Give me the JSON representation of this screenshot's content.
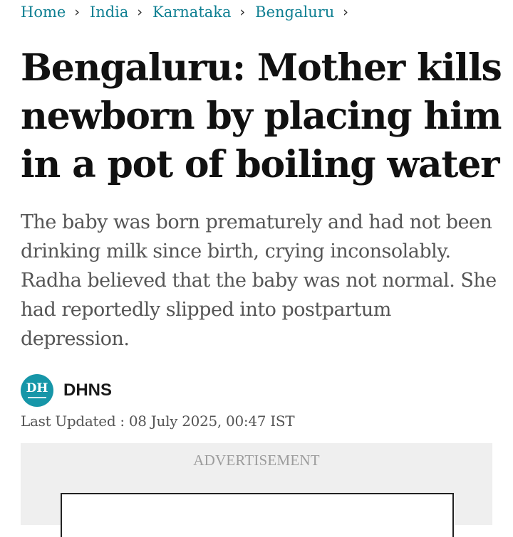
{
  "breadcrumb": {
    "items": [
      {
        "label": "Home"
      },
      {
        "label": "India"
      },
      {
        "label": "Karnataka"
      },
      {
        "label": "Bengaluru"
      }
    ],
    "separator": "›"
  },
  "article": {
    "headline": "Bengaluru: Mother kills newborn by placing him in a pot of boiling water",
    "summary": "The baby was born prematurely and had not been drinking milk since birth, crying inconsolably. Radha believed that the baby was not normal. She had reportedly slipped into postpartum depression.",
    "author": {
      "logo_text": "DH",
      "name": "DHNS"
    },
    "last_updated": "Last Updated : 08 July 2025, 00:47 IST"
  },
  "ad": {
    "label": "ADVERTISEMENT"
  },
  "colors": {
    "link": "#0e7f92",
    "avatar_bg": "#1696a8",
    "summary_text": "#555555",
    "ad_bg": "#efefef"
  }
}
